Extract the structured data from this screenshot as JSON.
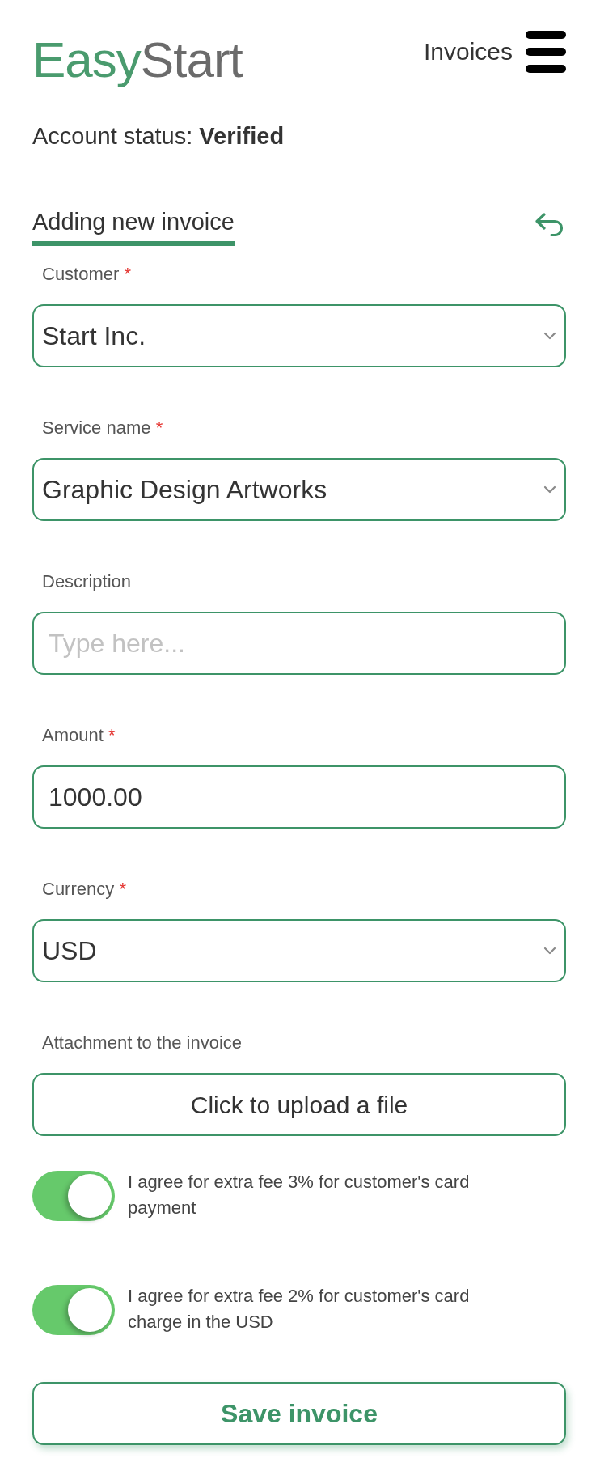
{
  "header": {
    "logo": {
      "part_1": "Easy",
      "part_2": "Start"
    },
    "nav_link": "Invoices"
  },
  "account_status": "Account status: **Verified**",
  "section": {
    "title": "Adding new invoice"
  },
  "fields": [
    {
      "kind": "select",
      "label": "Customer",
      "required_mark": "*",
      "value": "Start Inc."
    },
    {
      "kind": "select",
      "label": "Service name",
      "required_mark": "*",
      "value": "Graphic Design Artworks"
    },
    {
      "kind": "text",
      "label": "Description",
      "placeholder": "Type here..."
    },
    {
      "kind": "text",
      "label": "Amount",
      "required_mark": "*",
      "value": "1000.00"
    },
    {
      "kind": "select",
      "label": "Currency",
      "required_mark": "*",
      "value": "USD"
    },
    {
      "kind": "upload",
      "label": "Attachment to the invoice",
      "button": "Click to upload a file"
    }
  ],
  "toggles": [
    {
      "label": "I agree for extra fee 3% for customer's card payment",
      "on": true
    },
    {
      "label": "I agree for extra fee 2% for customer's card charge in the USD",
      "on": true
    }
  ],
  "save_button": "Save invoice"
}
